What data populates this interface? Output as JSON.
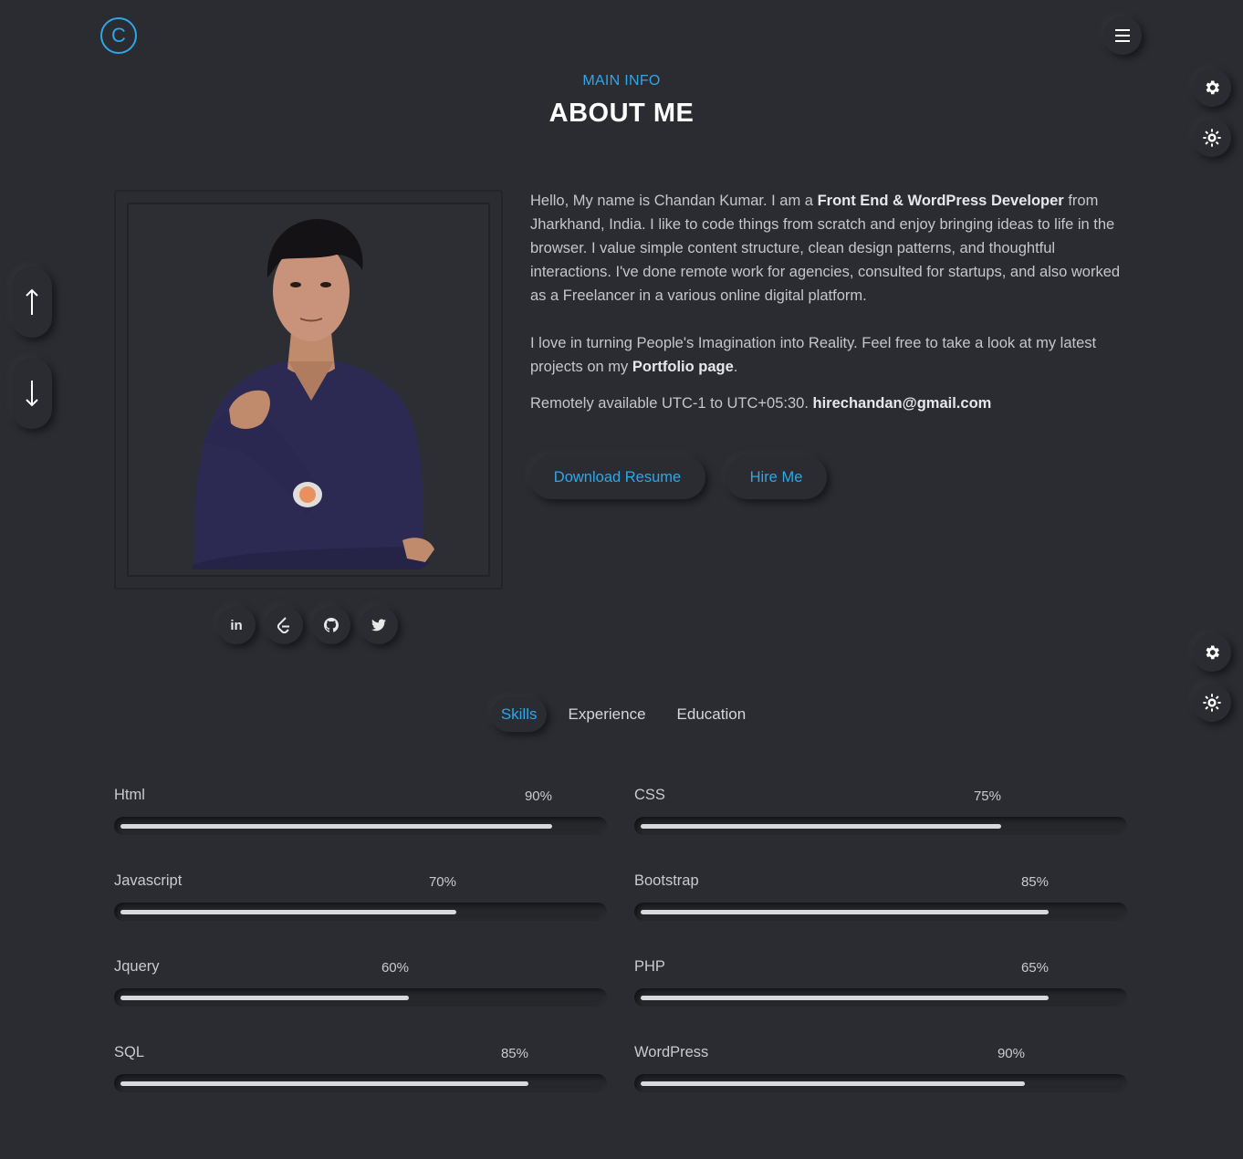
{
  "header": {
    "logo_letter": "C"
  },
  "section": {
    "subtitle": "MAIN INFO",
    "title": "ABOUT ME"
  },
  "about": {
    "p1_start": "Hello, My name is Chandan Kumar. I am a ",
    "p1_bold": "Front End & WordPress Developer",
    "p1_end": " from Jharkhand, India. I like to code things from scratch and enjoy bringing ideas to life in the browser. I value simple content structure, clean design patterns, and thoughtful interactions. I've done remote work for agencies, consulted for startups, and also worked as a Freelancer in a various online digital platform.",
    "p2_start": "I love in turning People's Imagination into Reality. Feel free to take a look at my latest projects on my ",
    "p2_bold": "Portfolio page",
    "p2_end": ".",
    "avail_start": "Remotely available UTC-1 to UTC+05:30. ",
    "avail_email": "hirechandan@gmail.com"
  },
  "buttons": {
    "resume": "Download Resume",
    "hire": "Hire Me"
  },
  "socials": {
    "linkedin": "in"
  },
  "tabs": [
    {
      "label": "Skills"
    },
    {
      "label": "Experience"
    },
    {
      "label": "Education"
    }
  ],
  "skills": [
    {
      "name": "Html",
      "pct_label": "90%",
      "value": 0.9
    },
    {
      "name": "CSS",
      "pct_label": "75%",
      "value": 0.75
    },
    {
      "name": "Javascript",
      "pct_label": "70%",
      "value": 0.7
    },
    {
      "name": "Bootstrap",
      "pct_label": "85%",
      "value": 0.85
    },
    {
      "name": "Jquery",
      "pct_label": "60%",
      "value": 0.6
    },
    {
      "name": "PHP",
      "pct_label": "65%",
      "value": 0.85
    },
    {
      "name": "SQL",
      "pct_label": "85%",
      "value": 0.85
    },
    {
      "name": "WordPress",
      "pct_label": "90%",
      "value": 0.8
    }
  ],
  "colors": {
    "accent": "#2ea7e8",
    "background": "#2a2c31"
  }
}
